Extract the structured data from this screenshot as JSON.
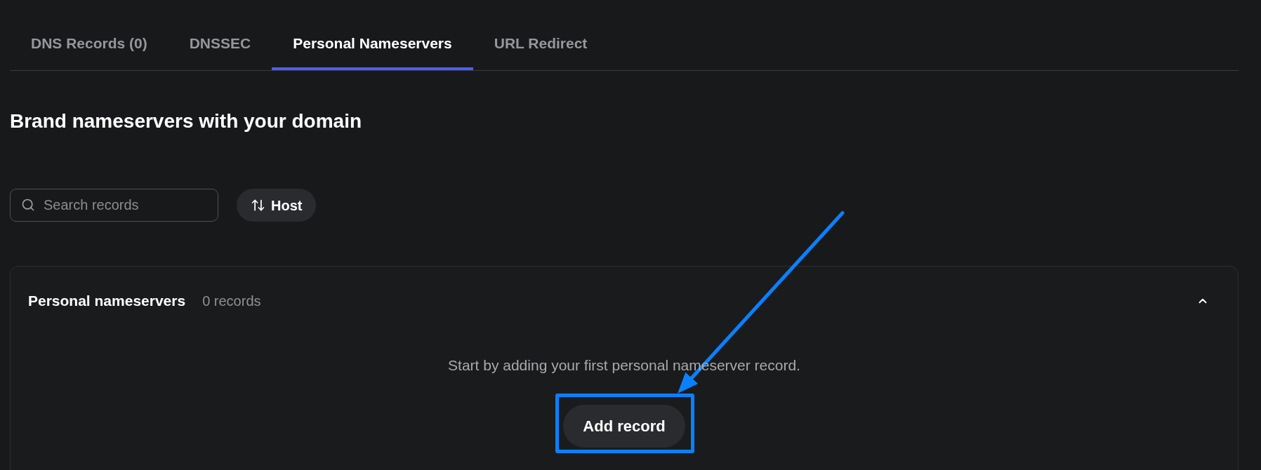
{
  "tabs": [
    {
      "label": "DNS Records (0)",
      "selected": false
    },
    {
      "label": "DNSSEC",
      "selected": false
    },
    {
      "label": "Personal Nameservers",
      "selected": true
    },
    {
      "label": "URL Redirect",
      "selected": false
    }
  ],
  "heading": "Brand nameservers with your domain",
  "toolbar": {
    "search": {
      "placeholder": "Search records"
    },
    "sort_button": {
      "label": "Host"
    }
  },
  "section": {
    "title": "Personal nameservers",
    "count": "0 records",
    "expanded": true,
    "empty_message": "Start by adding your first personal nameserver record.",
    "add_button": {
      "label": "Add record",
      "highlighted": true
    }
  }
}
